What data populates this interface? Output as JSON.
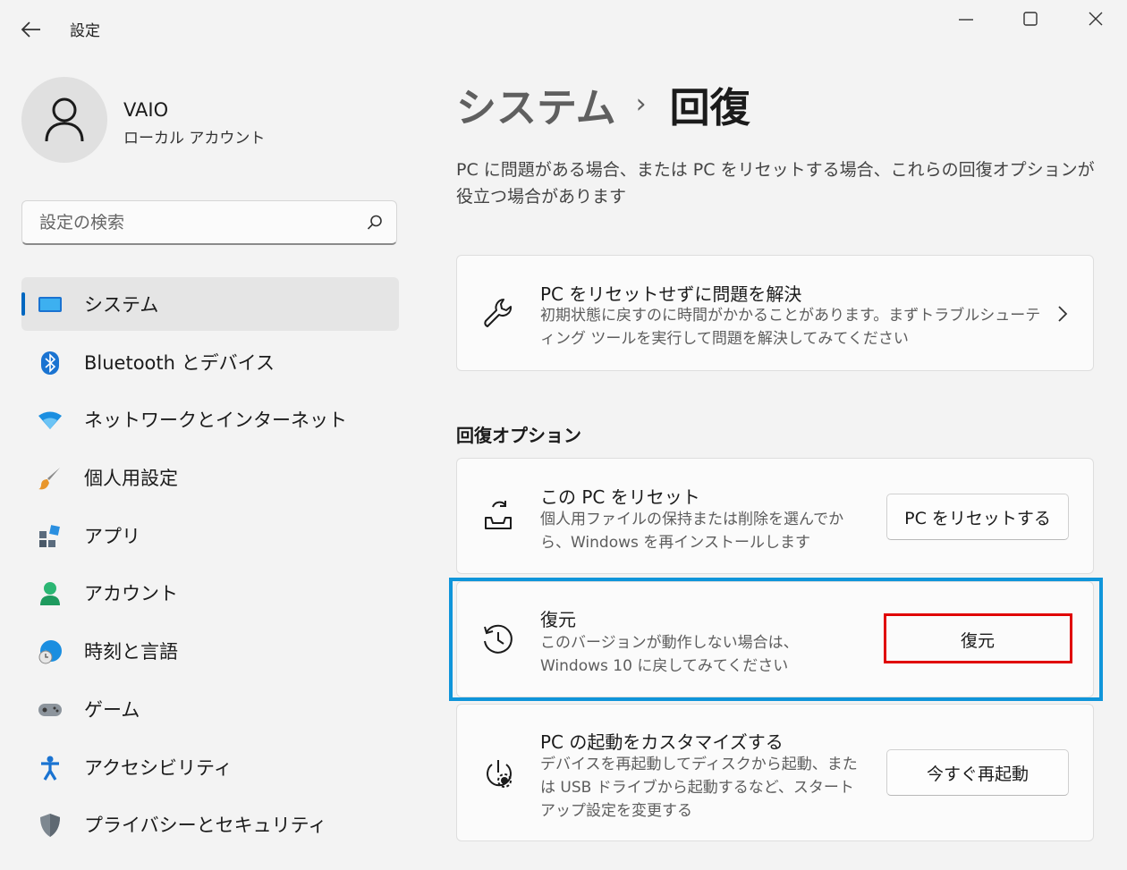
{
  "window": {
    "title": "設定",
    "controls": [
      "minimize-icon",
      "maximize-icon",
      "close-icon"
    ]
  },
  "profile": {
    "name": "VAIO",
    "account_type": "ローカル アカウント"
  },
  "search": {
    "placeholder": "設定の検索"
  },
  "sidebar": {
    "items": [
      {
        "label": "システム",
        "icon": "monitor-icon",
        "active": true
      },
      {
        "label": "Bluetooth とデバイス",
        "icon": "bluetooth-icon"
      },
      {
        "label": "ネットワークとインターネット",
        "icon": "wifi-icon"
      },
      {
        "label": "個人用設定",
        "icon": "brush-icon"
      },
      {
        "label": "アプリ",
        "icon": "apps-icon"
      },
      {
        "label": "アカウント",
        "icon": "person-icon"
      },
      {
        "label": "時刻と言語",
        "icon": "globe-clock-icon"
      },
      {
        "label": "ゲーム",
        "icon": "gamepad-icon"
      },
      {
        "label": "アクセシビリティ",
        "icon": "accessibility-icon"
      },
      {
        "label": "プライバシーとセキュリティ",
        "icon": "shield-icon"
      }
    ]
  },
  "breadcrumb": {
    "parent": "システム",
    "separator": "›",
    "current": "回復"
  },
  "page": {
    "description": "PC に問題がある場合、または PC をリセットする場合、これらの回復オプションが役立つ場合があります"
  },
  "troubleshoot_card": {
    "icon": "wrench-icon",
    "title": "PC をリセットせずに問題を解決",
    "description": "初期状態に戻すのに時間がかかることがあります。まずトラブルシューティング ツールを実行して問題を解決してみてください"
  },
  "recovery_options": {
    "heading": "回復オプション",
    "reset": {
      "icon": "reset-pc-icon",
      "title": "この PC をリセット",
      "description": "個人用ファイルの保持または削除を選んでから、Windows を再インストールします",
      "button": "PC をリセットする"
    },
    "goback": {
      "icon": "history-icon",
      "title": "復元",
      "description": "このバージョンが動作しない場合は、Windows 10 に戻してみてください",
      "button": "復元"
    },
    "advanced": {
      "icon": "advanced-startup-icon",
      "title": "PC の起動をカスタマイズする",
      "description": "デバイスを再起動してディスクから起動、または USB ドライブから起動するなど、スタートアップ設定を変更する",
      "button": "今すぐ再起動"
    }
  },
  "colors": {
    "accent": "#0067c0",
    "highlight_blue": "#0f95da",
    "highlight_red": "#e00000",
    "background": "#f3f3f3",
    "card": "#fbfbfb"
  }
}
